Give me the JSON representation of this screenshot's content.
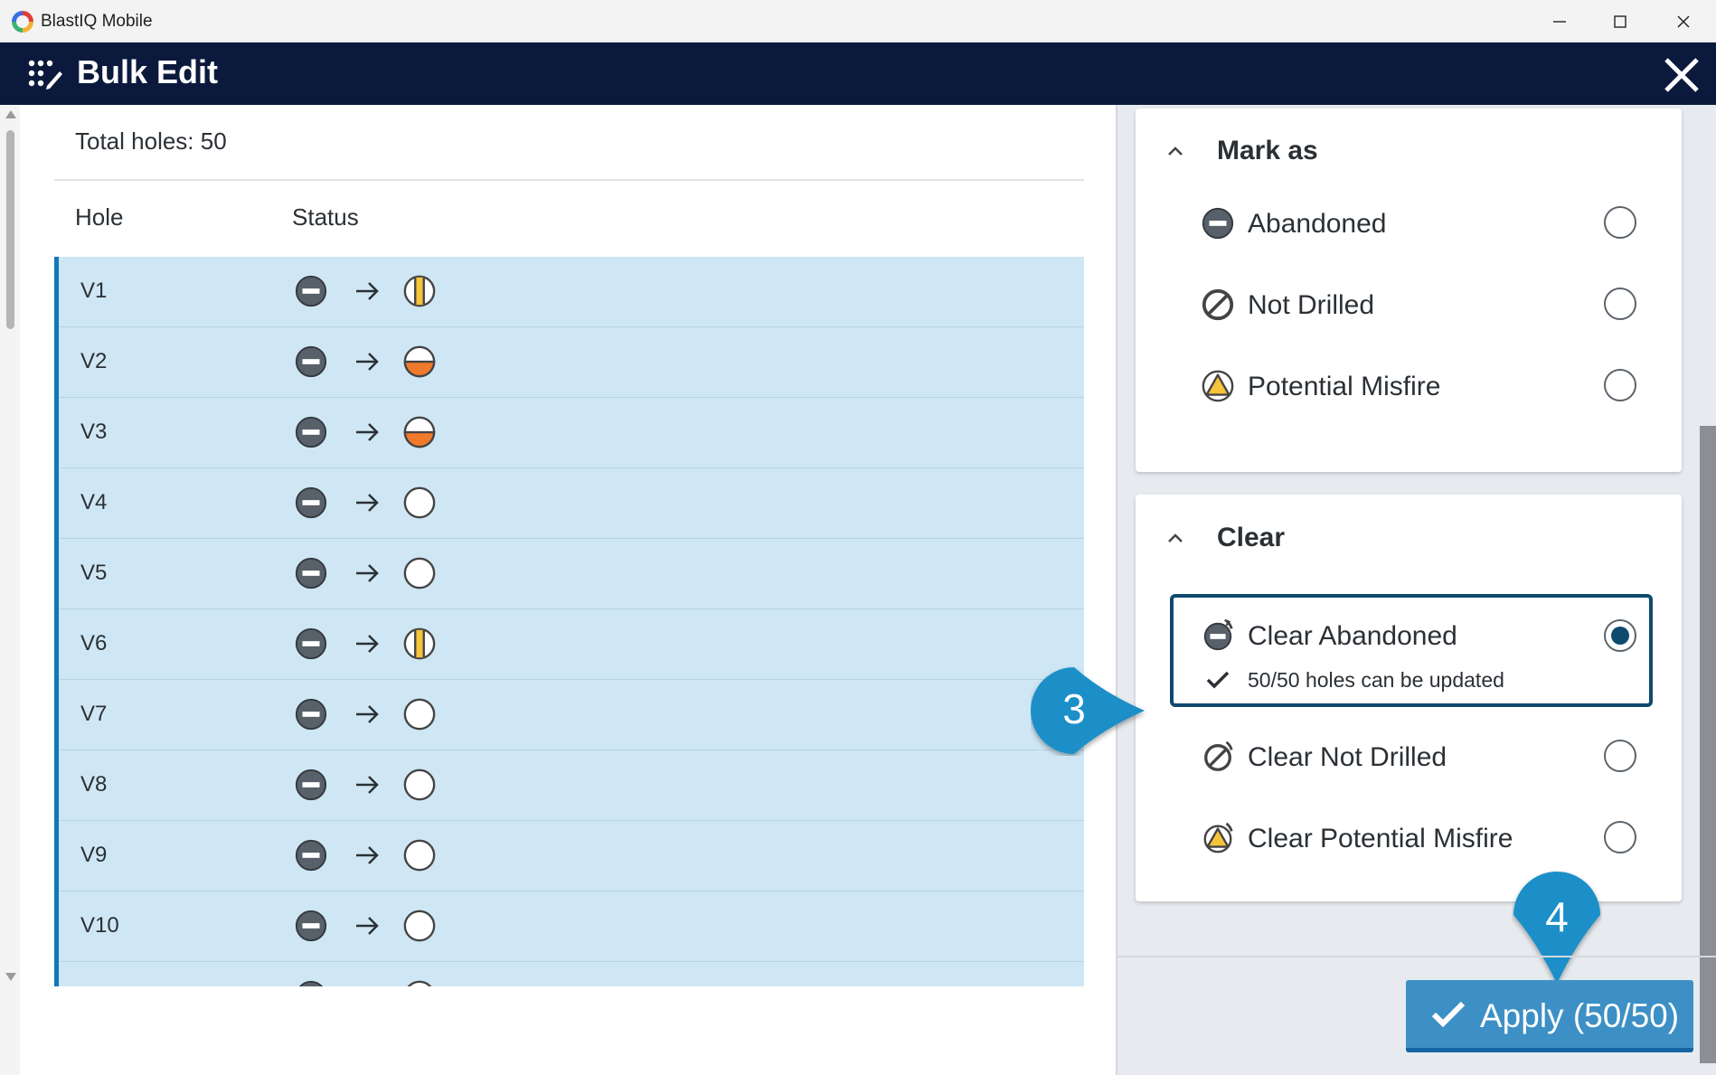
{
  "window": {
    "app_name": "BlastIQ Mobile"
  },
  "header": {
    "title": "Bulk Edit"
  },
  "left": {
    "total_holes": "Total holes: 50",
    "columns": {
      "hole": "Hole",
      "status": "Status"
    },
    "rows": [
      {
        "hole": "V1",
        "from": "abandoned-icon",
        "to": "primed-yellow-icon"
      },
      {
        "hole": "V2",
        "from": "abandoned-icon",
        "to": "half-orange-icon"
      },
      {
        "hole": "V3",
        "from": "abandoned-icon",
        "to": "half-orange-icon"
      },
      {
        "hole": "V4",
        "from": "abandoned-icon",
        "to": "empty-hole-icon"
      },
      {
        "hole": "V5",
        "from": "abandoned-icon",
        "to": "empty-hole-icon"
      },
      {
        "hole": "V6",
        "from": "abandoned-icon",
        "to": "primed-yellow-icon"
      },
      {
        "hole": "V7",
        "from": "abandoned-icon",
        "to": "empty-hole-icon"
      },
      {
        "hole": "V8",
        "from": "abandoned-icon",
        "to": "empty-hole-icon"
      },
      {
        "hole": "V9",
        "from": "abandoned-icon",
        "to": "empty-hole-icon"
      },
      {
        "hole": "V10",
        "from": "abandoned-icon",
        "to": "empty-hole-icon"
      },
      {
        "hole": "",
        "from": "abandoned-icon",
        "to": "empty-hole-icon"
      }
    ]
  },
  "mark_as": {
    "title": "Mark as",
    "options": [
      {
        "label": "Abandoned",
        "icon": "abandoned-icon",
        "selected": false
      },
      {
        "label": "Not Drilled",
        "icon": "not-drilled-icon",
        "selected": false
      },
      {
        "label": "Potential Misfire",
        "icon": "potential-misfire-icon",
        "selected": false
      }
    ]
  },
  "clear": {
    "title": "Clear",
    "options": [
      {
        "label": "Clear Abandoned",
        "icon": "clear-abandoned-icon",
        "selected": true,
        "sub": "50/50 holes can be updated"
      },
      {
        "label": "Clear Not Drilled",
        "icon": "clear-not-drilled-icon",
        "selected": false
      },
      {
        "label": "Clear Potential Misfire",
        "icon": "clear-potential-misfire-icon",
        "selected": false
      }
    ]
  },
  "callouts": {
    "step3": "3",
    "step4": "4"
  },
  "apply": {
    "label": "Apply (50/50)"
  },
  "colors": {
    "header_bg": "#0b1a3c",
    "row_bg": "#cfe7f4",
    "accent": "#1378b8",
    "apply_bg": "#3d90c5",
    "callout": "#1a8fc9"
  }
}
